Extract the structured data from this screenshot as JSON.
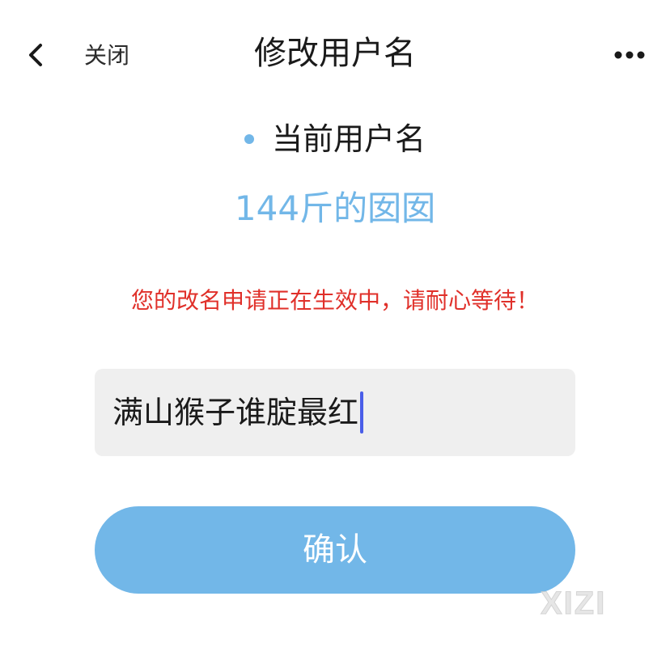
{
  "nav": {
    "back_icon": "chevron-left-icon",
    "close_label": "关闭",
    "title": "修改用户名",
    "more_icon": "more-horizontal-icon"
  },
  "current": {
    "label": "当前用户名",
    "username": "144斤的囡囡"
  },
  "notice": "您的改名申请正在生效中，请耐心等待！",
  "input": {
    "value": "满山猴子谁腚最红"
  },
  "confirm_label": "确认",
  "watermark": "XIZI",
  "colors": {
    "accent": "#72b7e8",
    "warning": "#e0302a",
    "input_bg": "#efefef",
    "caret": "#4a5ee8"
  }
}
